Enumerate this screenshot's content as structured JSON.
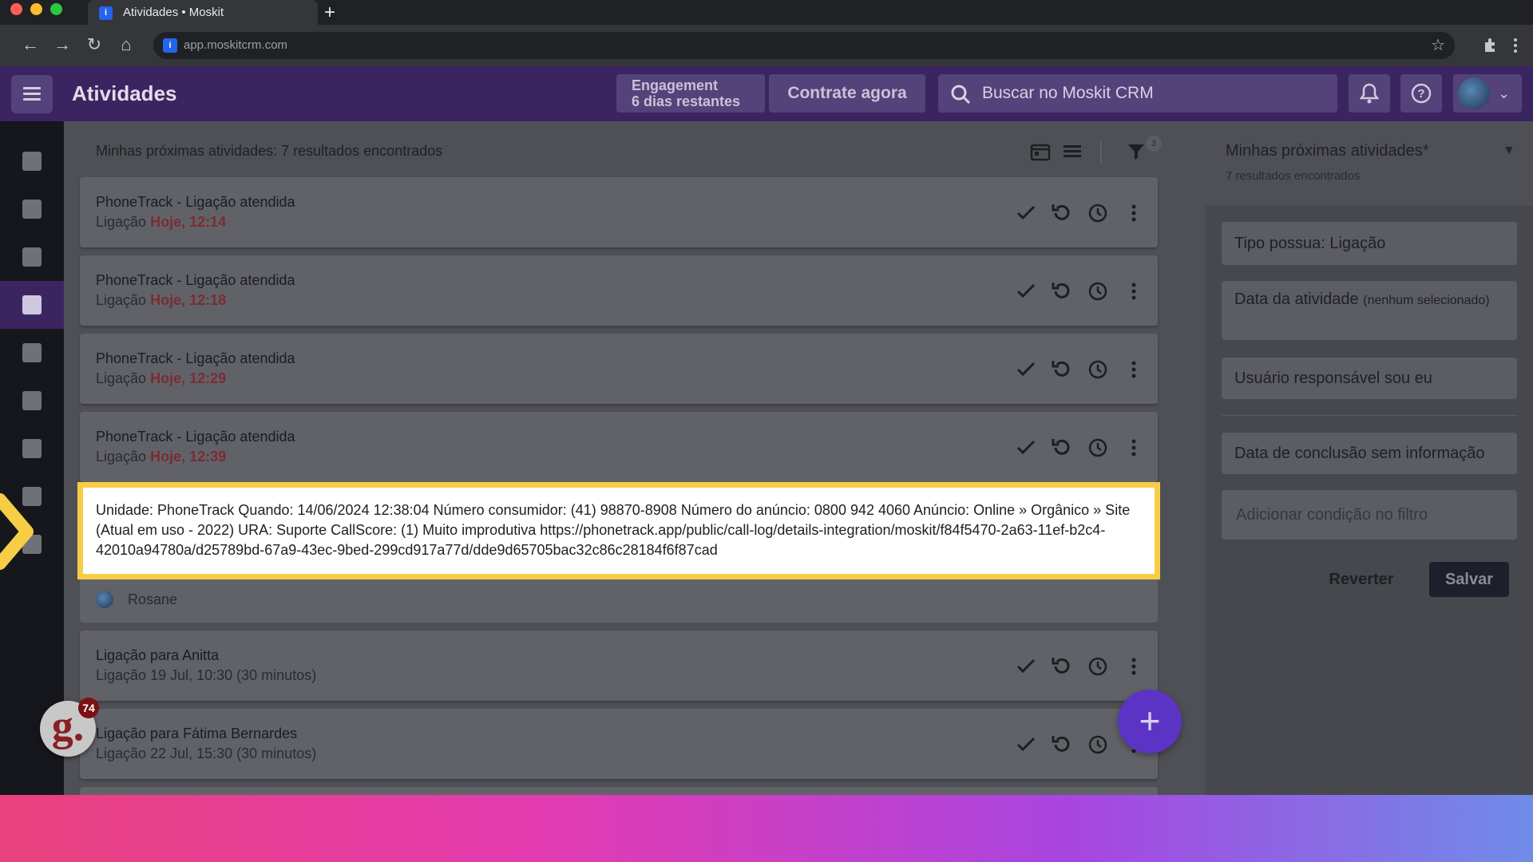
{
  "browser": {
    "tab_title": "Atividades • Moskit",
    "favicon_letter": "i",
    "new_tab": "+",
    "url": "app.moskitcrm.com"
  },
  "header": {
    "title": "Atividades",
    "engagement_line1": "Engagement",
    "engagement_line2": "6 dias restantes",
    "hire_label": "Contrate agora",
    "search_placeholder": "Buscar no Moskit CRM"
  },
  "list": {
    "summary": "Minhas próximas atividades: 7 resultados encontrados",
    "filter_count": "3",
    "cards": [
      {
        "title": "PhoneTrack - Ligação atendida",
        "type": "Ligação",
        "when": "Hoje, 12:14",
        "overdue": true
      },
      {
        "title": "PhoneTrack - Ligação atendida",
        "type": "Ligação",
        "when": "Hoje, 12:18",
        "overdue": true
      },
      {
        "title": "PhoneTrack - Ligação atendida",
        "type": "Ligação",
        "when": "Hoje, 12:29",
        "overdue": true
      },
      {
        "title": "PhoneTrack - Ligação atendida",
        "type": "Ligação",
        "when": "Hoje, 12:39",
        "overdue": true
      },
      {
        "title": "Ligação para Anitta",
        "type": "Ligação",
        "when": "19 Jul, 10:30 (30 minutos)",
        "overdue": false
      },
      {
        "title": "Ligação para Fátima Bernardes",
        "type": "Ligação",
        "when": "22 Jul, 15:30 (30 minutos)",
        "overdue": false
      }
    ],
    "expanded_person": "Rosane",
    "description": "Unidade: PhoneTrack Quando: 14/06/2024 12:38:04 Número consumidor: (41) 98870-8908 Número do anúncio: 0800 942 4060 Anúncio: Online » Orgânico » Site (Atual em uso - 2022) URA: Suporte CallScore: (1) Muito improdutiva https://phonetrack.app/public/call-log/details-integration/moskit/f84f5470-2a63-11ef-b2c4-42010a94780a/d25789bd-67a9-43ec-9bed-299cd917a77d/dde9d65705bac32c86c28184f6f87cad"
  },
  "filters": {
    "title": "Minhas próximas atividades*",
    "subtitle": "7 resultados encontrados",
    "type": "Tipo possua: Ligação",
    "date_main": "Data da atividade ",
    "date_sub": "(nenhum selecionado)",
    "owner": "Usuário responsável sou eu",
    "completion": "Data de conclusão sem informação",
    "add_condition": "Adicionar condição no filtro",
    "revert": "Reverter",
    "save": "Salvar"
  },
  "overlay": {
    "g_letter": "g.",
    "g_count": "74",
    "fab_label": "+"
  },
  "colors": {
    "header": "#3b2560",
    "fab": "#5b34c6",
    "highlight_border": "#f7cd46",
    "overdue": "#7a2c32"
  }
}
